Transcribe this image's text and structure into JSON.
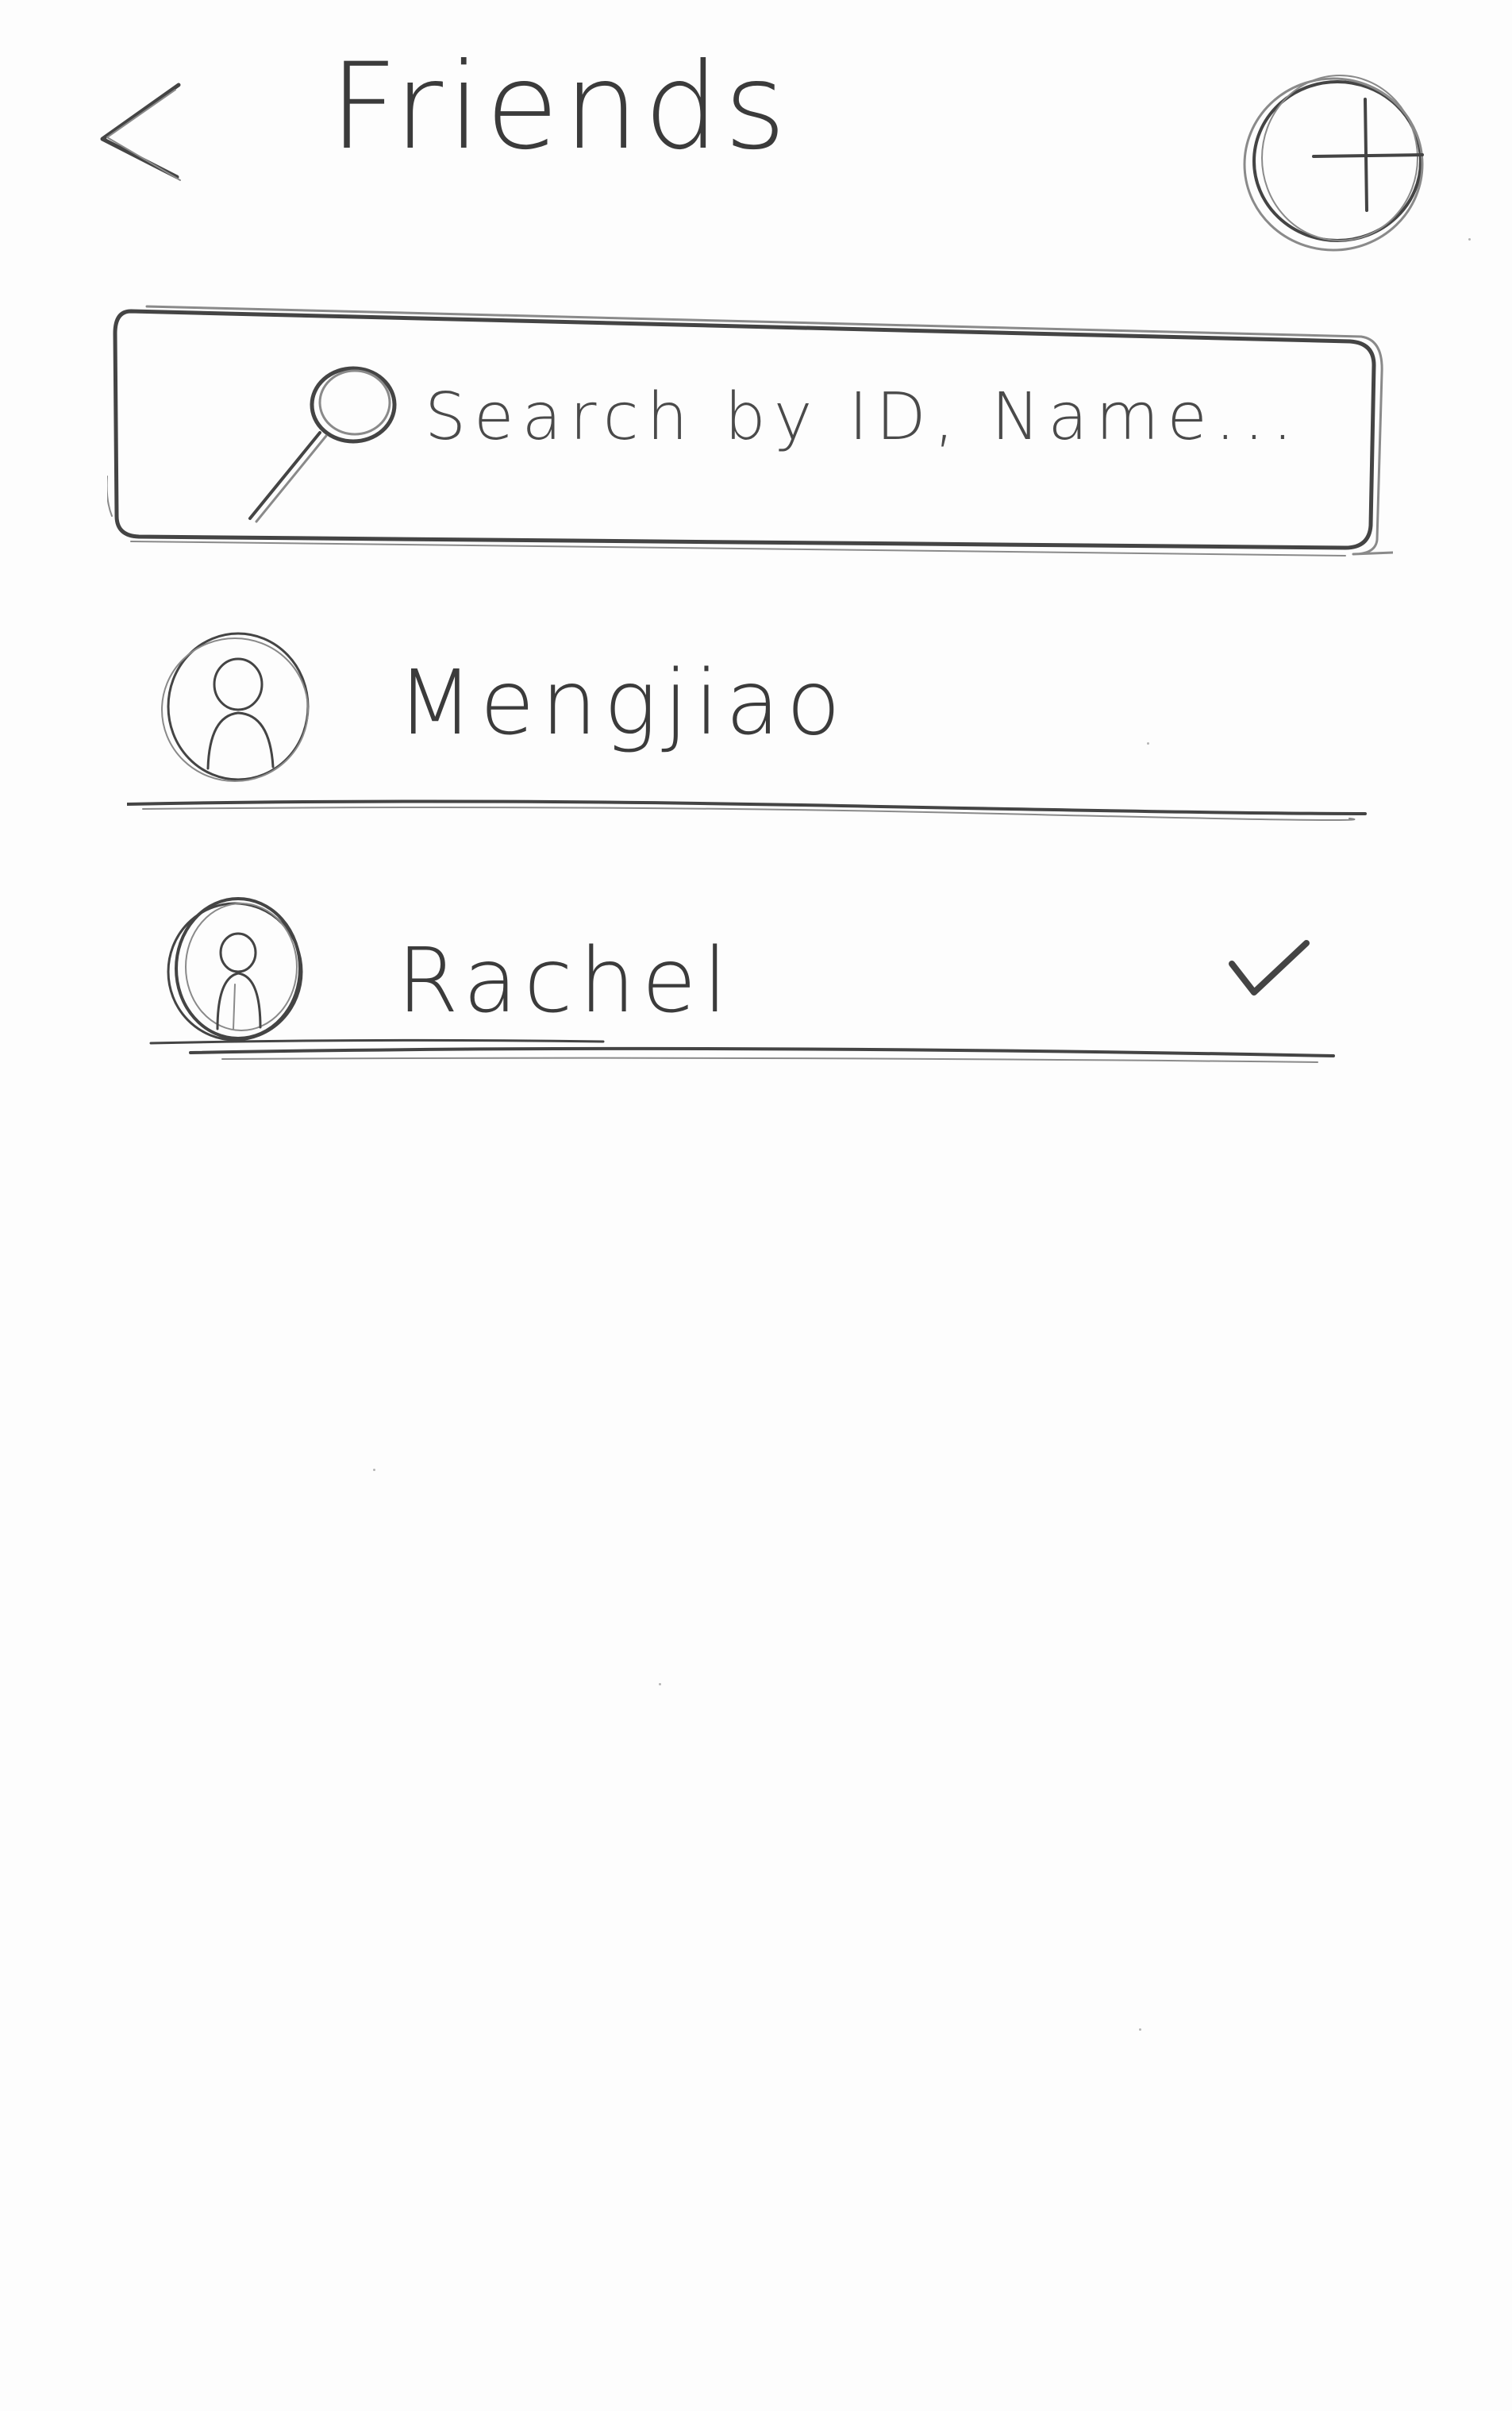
{
  "header": {
    "back_icon": "chevron-left-icon",
    "title": "Friends",
    "add_icon": "plus-circle-icon"
  },
  "search": {
    "icon": "magnifier-icon",
    "placeholder": "Search by ID, Name..."
  },
  "friends": [
    {
      "name": "Mengjiao",
      "avatar_icon": "user-avatar-icon",
      "selected": false
    },
    {
      "name": "Rachel",
      "avatar_icon": "user-avatar-icon",
      "selected": true,
      "status_icon": "checkmark-icon"
    }
  ],
  "colors": {
    "pencil": "#444444",
    "paper": "#fdfdfd"
  }
}
